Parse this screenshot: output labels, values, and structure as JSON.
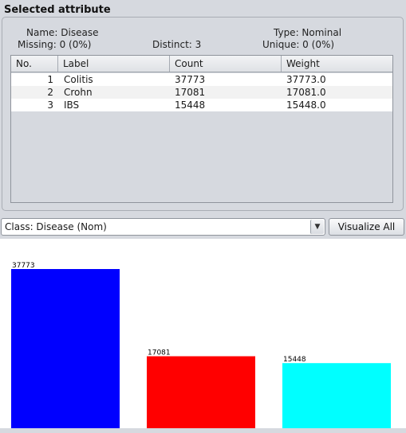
{
  "selected_attribute": {
    "title": "Selected attribute",
    "name_text": "Name: Disease",
    "missing_text": "Missing: 0 (0%)",
    "distinct_text": "Distinct: 3",
    "type_text": "Type: Nominal",
    "unique_text": "Unique: 0 (0%)"
  },
  "table": {
    "headers": [
      "No.",
      "Label",
      "Count",
      "Weight"
    ],
    "rows": [
      {
        "no": "1",
        "label": "Colitis",
        "count": "37773",
        "weight": "37773.0"
      },
      {
        "no": "2",
        "label": "Crohn",
        "count": "17081",
        "weight": "17081.0"
      },
      {
        "no": "3",
        "label": "IBS",
        "count": "15448",
        "weight": "15448.0"
      }
    ]
  },
  "class_selector": {
    "value": "Class: Disease (Nom)",
    "icon": "chevron-down-icon"
  },
  "visualize_all_label": "Visualize All",
  "chart_data": {
    "type": "bar",
    "categories": [
      "Colitis",
      "Crohn",
      "IBS"
    ],
    "values": [
      37773,
      17081,
      15448
    ],
    "data_labels": [
      "37773",
      "17081",
      "15448"
    ],
    "colors": [
      "#0000ff",
      "#ff0000",
      "#00ffff"
    ],
    "ylim": [
      0,
      37773
    ]
  }
}
